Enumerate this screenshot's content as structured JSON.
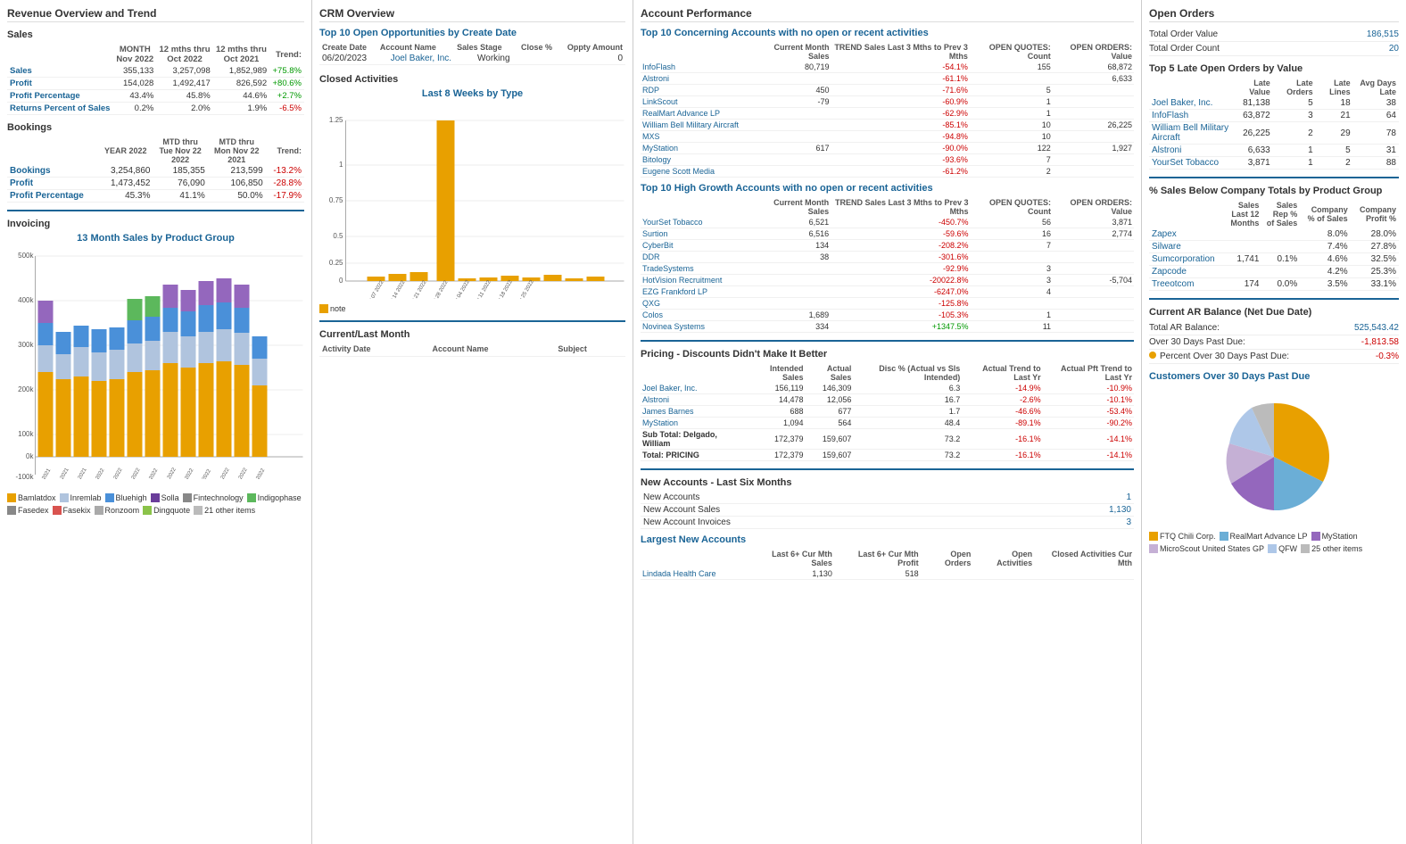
{
  "panel1": {
    "title": "Revenue Overview and Trend",
    "sales_section": "Sales",
    "sales_headers": [
      "",
      "MONTH Nov 2022",
      "12 mths thru Oct 2022",
      "12 mths thru Oct 2021",
      "Trend:"
    ],
    "sales_rows": [
      {
        "label": "Sales",
        "m": "355,133",
        "y1": "3,257,098",
        "y2": "1,852,989",
        "trend": "+75.8%",
        "trend_pos": true
      },
      {
        "label": "Profit",
        "m": "154,028",
        "y1": "1,492,417",
        "y2": "826,592",
        "trend": "+80.6%",
        "trend_pos": true
      },
      {
        "label": "Profit Percentage",
        "m": "43.4%",
        "y1": "45.8%",
        "y2": "44.6%",
        "trend": "+2.7%",
        "trend_pos": true
      },
      {
        "label": "Returns Percent of Sales",
        "m": "0.2%",
        "y1": "2.0%",
        "y2": "1.9%",
        "trend": "-6.5%",
        "trend_pos": false
      }
    ],
    "bookings_section": "Bookings",
    "bookings_headers": [
      "",
      "YEAR 2022",
      "MTD thru Tue Nov 22 2022",
      "MTD thru Mon Nov 22 2021",
      "Trend:"
    ],
    "bookings_rows": [
      {
        "label": "Bookings",
        "y": "3,254,860",
        "m1": "185,355",
        "m2": "213,599",
        "trend": "-13.2%",
        "trend_pos": false
      },
      {
        "label": "Profit",
        "y": "1,473,452",
        "m1": "76,090",
        "m2": "106,850",
        "trend": "-28.8%",
        "trend_pos": false
      },
      {
        "label": "Profit Percentage",
        "y": "45.3%",
        "m1": "41.1%",
        "m2": "50.0%",
        "trend": "-17.9%",
        "trend_pos": false
      }
    ],
    "invoicing_title": "Invoicing",
    "chart_title": "13 Month Sales by Product Group",
    "chart_months": [
      "Oct 2021",
      "Nov 2021",
      "Dec 2021",
      "Jan 2022",
      "Feb 2022",
      "Mar 2022",
      "Apr 2022",
      "May 2022",
      "Jun 2022",
      "Jul 2022",
      "Aug 2022",
      "Sep 2022",
      "Oct 2022"
    ],
    "legend_items": [
      {
        "label": "Bamlatdox",
        "color": "#e8a000"
      },
      {
        "label": "Inremlab",
        "color": "#b0c4de"
      },
      {
        "label": "Bluehigh",
        "color": "#4a90d9"
      },
      {
        "label": "Solla",
        "color": "#6a3d9a"
      },
      {
        "label": "Fintechnology",
        "color": "#888"
      },
      {
        "label": "Indigophase",
        "color": "#5cb85c"
      },
      {
        "label": "Fasedex",
        "color": "#888"
      },
      {
        "label": "Fasekix",
        "color": "#d9534f"
      },
      {
        "label": "Ronzoom",
        "color": "#aaa"
      },
      {
        "label": "Dingquote",
        "color": "#8bc34a"
      },
      {
        "label": "21 other items",
        "color": "#bbb"
      }
    ]
  },
  "panel2": {
    "title": "CRM Overview",
    "top_opps_title": "Top 10 Open Opportunities by Create Date",
    "opps_headers": [
      "Create Date",
      "Account Name",
      "Sales Stage",
      "Close %",
      "Oppty Amount"
    ],
    "opps_rows": [
      {
        "date": "06/20/2023",
        "account": "Joel Baker, Inc.",
        "stage": "Working",
        "close": "",
        "amount": "0"
      }
    ],
    "closed_title": "Closed Activities",
    "chart_subtitle": "Last 8 Weeks by Type",
    "legend_note": "note",
    "current_title": "Current/Last Month",
    "activity_headers": [
      "Activity Date",
      "Account Name",
      "Subject"
    ]
  },
  "panel3": {
    "title": "Account Performance",
    "concerning_title": "Top 10 Concerning Accounts with no open or recent activities",
    "concerning_headers": [
      "",
      "Current Month Sales",
      "TREND Sales Last 3 Mths to Prev 3 Mths",
      "OPEN QUOTES: Count",
      "OPEN ORDERS: Value"
    ],
    "concerning_rows": [
      {
        "account": "InfoFlash",
        "cms": "80,719",
        "trend": "-54.1%",
        "qc": "155",
        "ov": "68,872"
      },
      {
        "account": "Alstroni",
        "cms": "",
        "trend": "-61.1%",
        "qc": "",
        "ov": "6,633"
      },
      {
        "account": "RDP",
        "cms": "450",
        "trend": "-71.6%",
        "qc": "5",
        "ov": ""
      },
      {
        "account": "LinkScout",
        "cms": "-79",
        "trend": "-60.9%",
        "qc": "1",
        "ov": ""
      },
      {
        "account": "RealMart Advance LP",
        "cms": "",
        "trend": "-62.9%",
        "qc": "1",
        "ov": ""
      },
      {
        "account": "William Bell Military Aircraft",
        "cms": "",
        "trend": "-85.1%",
        "qc": "10",
        "ov": "26,225"
      },
      {
        "account": "MXS",
        "cms": "",
        "trend": "-94.8%",
        "qc": "10",
        "ov": ""
      },
      {
        "account": "MyStation",
        "cms": "617",
        "trend": "-90.0%",
        "qc": "122",
        "ov": "1,927"
      },
      {
        "account": "Bitology",
        "cms": "",
        "trend": "-93.6%",
        "qc": "7",
        "ov": ""
      },
      {
        "account": "Eugene Scott Media",
        "cms": "",
        "trend": "-61.2%",
        "qc": "2",
        "ov": ""
      }
    ],
    "highgrowth_title": "Top 10 High Growth Accounts with no open or recent activities",
    "highgrowth_headers": [
      "",
      "Current Month Sales",
      "TREND Sales Last 3 Mths to Prev 3 Mths",
      "OPEN QUOTES: Count",
      "OPEN ORDERS: Value"
    ],
    "highgrowth_rows": [
      {
        "account": "YourSet Tobacco",
        "cms": "6,521",
        "trend": "-450.7%",
        "qc": "56",
        "ov": "3,871"
      },
      {
        "account": "Surtion",
        "cms": "6,516",
        "trend": "-59.6%",
        "qc": "16",
        "ov": "2,774"
      },
      {
        "account": "CyberBit",
        "cms": "134",
        "trend": "-208.2%",
        "qc": "7",
        "ov": ""
      },
      {
        "account": "DDR",
        "cms": "38",
        "trend": "-301.6%",
        "qc": "",
        "ov": ""
      },
      {
        "account": "TradeSystems",
        "cms": "",
        "trend": "-92.9%",
        "qc": "3",
        "ov": ""
      },
      {
        "account": "HotVision Recruitment",
        "cms": "",
        "trend": "-20022.8%",
        "qc": "3",
        "ov": "-5,704"
      },
      {
        "account": "EZG Frankford LP",
        "cms": "",
        "trend": "-6247.0%",
        "qc": "4",
        "ov": ""
      },
      {
        "account": "QXG",
        "cms": "",
        "trend": "-125.8%",
        "qc": "",
        "ov": ""
      },
      {
        "account": "Colos",
        "cms": "1,689",
        "trend": "-105.3%",
        "qc": "1",
        "ov": ""
      },
      {
        "account": "Novinea Systems",
        "cms": "334",
        "trend": "+1347.5%",
        "qc": "11",
        "ov": ""
      }
    ],
    "pricing_title": "Pricing - Discounts Didn't Make It Better",
    "pricing_headers": [
      "",
      "Intended Sales",
      "Actual Sales",
      "Disc % (Actual vs Sls Intended)",
      "Actual Trend to Last Yr",
      "Actual Pft Trend to Last Yr"
    ],
    "pricing_rows": [
      {
        "account": "Joel Baker, Inc.",
        "is": "156,119",
        "as": "146,309",
        "disc": "6.3",
        "trend_sls": "-14.9%",
        "trend_pft": "-10.9%"
      },
      {
        "account": "Alstroni",
        "is": "14,478",
        "as": "12,056",
        "disc": "16.7",
        "trend_sls": "-2.6%",
        "trend_pft": "-10.1%"
      },
      {
        "account": "James Barnes",
        "is": "688",
        "as": "677",
        "disc": "1.7",
        "trend_sls": "-46.6%",
        "trend_pft": "-53.4%"
      },
      {
        "account": "MyStation",
        "is": "1,094",
        "as": "564",
        "disc": "48.4",
        "trend_sls": "-89.1%",
        "trend_pft": "-90.2%"
      },
      {
        "account": "Sub Total: Delgado, William",
        "is": "172,379",
        "as": "159,607",
        "disc": "73.2",
        "trend_sls": "-16.1%",
        "trend_pft": "-14.1%",
        "bold": true
      },
      {
        "account": "Total: PRICING",
        "is": "172,379",
        "as": "159,607",
        "disc": "73.2",
        "trend_sls": "-16.1%",
        "trend_pft": "-14.1%",
        "bold": true
      }
    ],
    "new_accounts_title": "New Accounts - Last Six Months",
    "new_accounts_rows": [
      {
        "label": "New Accounts",
        "value": "1"
      },
      {
        "label": "New Account Sales",
        "value": "1,130"
      },
      {
        "label": "New Account Invoices",
        "value": "3"
      }
    ],
    "largest_title": "Largest New Accounts",
    "largest_headers": [
      "",
      "Last 6+ Cur Mth Sales",
      "Last 6+ Cur Mth Profit",
      "Open Orders",
      "Open Activities",
      "Closed Activities Cur Mth"
    ],
    "largest_rows": [
      {
        "account": "Lindada Health Care",
        "s": "1,130",
        "p": "518",
        "oo": "",
        "oa": "",
        "ca": ""
      }
    ]
  },
  "panel4": {
    "title": "Open Orders",
    "total_order_value_label": "Total Order Value",
    "total_order_value": "186,515",
    "total_order_count_label": "Total Order Count",
    "total_order_count": "20",
    "late_orders_title": "Top 5 Late Open Orders by Value",
    "late_headers": [
      "",
      "Late Value",
      "Late Orders",
      "Late Lines",
      "Avg Days Late"
    ],
    "late_rows": [
      {
        "account": "Joel Baker, Inc.",
        "lv": "81,138",
        "lo": "5",
        "ll": "18",
        "adl": "38"
      },
      {
        "account": "InfoFlash",
        "lv": "63,872",
        "lo": "3",
        "ll": "21",
        "adl": "64"
      },
      {
        "account": "William Bell Military Aircraft",
        "lv": "26,225",
        "lo": "2",
        "ll": "29",
        "adl": "78"
      },
      {
        "account": "Alstroni",
        "lv": "6,633",
        "lo": "1",
        "ll": "5",
        "adl": "31"
      },
      {
        "account": "YourSet Tobacco",
        "lv": "3,871",
        "lo": "1",
        "ll": "2",
        "adl": "88"
      }
    ],
    "pct_sales_title": "% Sales Below Company Totals by Product Group",
    "pct_headers": [
      "",
      "Sales Last 12 Months",
      "Sales Rep % of Sales",
      "Company % of Sales",
      "Company Profit %"
    ],
    "pct_rows": [
      {
        "group": "Zapex",
        "s": "",
        "srp": "",
        "cp": "8.0%",
        "pp": "28.0%"
      },
      {
        "group": "Silware",
        "s": "",
        "srp": "",
        "cp": "7.4%",
        "pp": "27.8%"
      },
      {
        "group": "Sumcorporation",
        "s": "1,741",
        "srp": "0.1%",
        "cp": "4.6%",
        "pp": "32.5%"
      },
      {
        "group": "Zapcode",
        "s": "",
        "srp": "",
        "cp": "4.2%",
        "pp": "25.3%"
      },
      {
        "group": "Treeotcom",
        "s": "174",
        "srp": "0.0%",
        "cp": "3.5%",
        "pp": "33.1%"
      }
    ],
    "ar_title": "Current AR Balance (Net Due Date)",
    "ar_rows": [
      {
        "label": "Total AR Balance:",
        "value": "525,543.42"
      },
      {
        "label": "Over 30 Days Past Due:",
        "value": "-1,813.58"
      },
      {
        "label": "Percent Over 30 Days Past Due:",
        "value": "-0.3%"
      }
    ],
    "customers_title": "Customers Over 30 Days Past Due",
    "pie_legend": [
      {
        "label": "FTQ Chili Corp.",
        "color": "#e8a000"
      },
      {
        "label": "RealMart Advance LP",
        "color": "#6baed6"
      },
      {
        "label": "MyStation",
        "color": "#9467bd"
      },
      {
        "label": "MicroScout United States GP",
        "color": "#c5b0d5"
      },
      {
        "label": "QFW",
        "color": "#aec7e8"
      },
      {
        "label": "25 other items",
        "color": "#bbb"
      }
    ]
  }
}
